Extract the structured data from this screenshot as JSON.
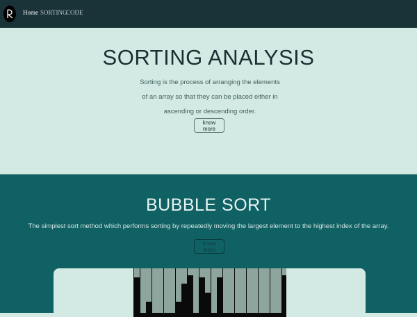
{
  "nav": {
    "items": [
      {
        "label": "Home",
        "active": true
      },
      {
        "label": "SORTING",
        "active": false
      },
      {
        "label": "CODE",
        "active": false
      }
    ]
  },
  "hero": {
    "title": "SORTING ANALYSIS",
    "description": "Sorting is the process of arranging the elements of an array so that they can be placed either in ascending or descending order.",
    "button_label": "know more"
  },
  "bubble_sort": {
    "title": "BUBBLE SORT",
    "description": "The simplest sort method which performs sorting by repeatedly moving the largest element to the highest index of the array.",
    "button_label": "know more"
  },
  "visualizer": {
    "bar_color": "#8ea59e",
    "canvas_color": "#0a0a0a",
    "bar_values": [
      0.2,
      1.0,
      0.75,
      1.0,
      1.0,
      1.0,
      1.0,
      0.75,
      0.35,
      0.15,
      1.0,
      0.2,
      0.55,
      1.0,
      0.2,
      1.0,
      1.0,
      1.0,
      1.0,
      1.0,
      1.0,
      1.0,
      1.0,
      1.0,
      1.0,
      0.15
    ]
  }
}
